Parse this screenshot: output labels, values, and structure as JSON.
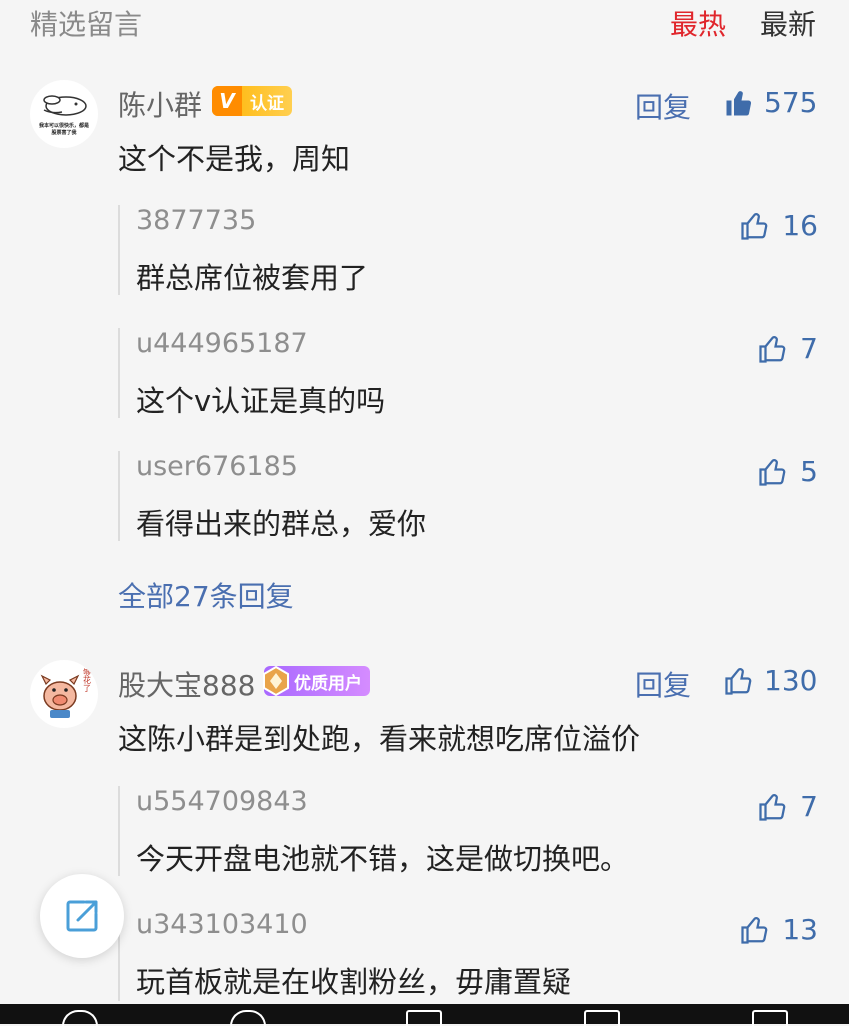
{
  "header": {
    "title": "精选留言",
    "tab_hot": "最热",
    "tab_new": "最新"
  },
  "colors": {
    "accent_red": "#e0262c",
    "link_blue": "#4a6fb0",
    "like_blue": "#3f6caa"
  },
  "comments": [
    {
      "user": "陈小群",
      "badge": "认证",
      "badge_mark": "V",
      "reply_label": "回复",
      "likes": "575",
      "text": "这个不是我，周知",
      "avatar_caption_1": "我本可以很快乐，都是",
      "avatar_caption_2": "股票害了我",
      "replies": [
        {
          "user": "3877735",
          "text": "群总席位被套用了",
          "likes": "16"
        },
        {
          "user": "u444965187",
          "text": "这个v认证是真的吗",
          "likes": "7"
        },
        {
          "user": "user676185",
          "text": "看得出来的群总，爱你",
          "likes": "5"
        }
      ],
      "all_replies": "全部27条回复"
    },
    {
      "user": "股大宝888",
      "badge": "优质用户",
      "reply_label": "回复",
      "likes": "130",
      "text": "这陈小群是到处跑，看来就想吃席位溢价",
      "avatar_caption": "够花了",
      "replies": [
        {
          "user": "u554709843",
          "text": "今天开盘电池就不错，这是做切换吧。",
          "likes": "7"
        },
        {
          "user": "u343103410",
          "text": "玩首板就是在收割粉丝，毋庸置疑",
          "likes": "13"
        }
      ]
    }
  ],
  "icons": {
    "like": "thumbs-up-icon",
    "share": "share-edit-icon"
  }
}
